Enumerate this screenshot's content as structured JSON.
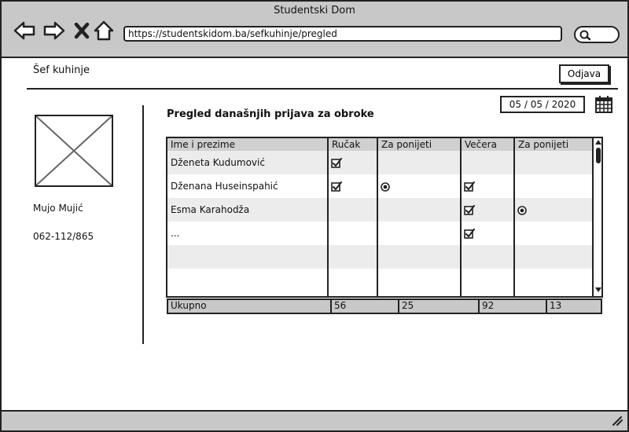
{
  "window": {
    "title": "Studentski Dom",
    "url": "https://studentskidom.ba/sefkuhinje/pregled"
  },
  "header": {
    "app_name": "Šef kuhinje",
    "logout_label": "Odjava"
  },
  "user": {
    "name": "Mujo Mujić",
    "phone": "062-112/865"
  },
  "main": {
    "title": "Pregled današnjih prijava za obroke",
    "date": "05 / 05 / 2020"
  },
  "table": {
    "columns": [
      "Ime i prezime",
      "Ručak",
      "Za ponijeti",
      "Večera",
      "Za ponijeti"
    ],
    "rows": [
      {
        "name": "Dženeta Kudumović",
        "rucak": true,
        "rucak_ponijeti": false,
        "vecera": false,
        "vecera_ponijeti": false
      },
      {
        "name": "Dženana Huseinspahić",
        "rucak": true,
        "rucak_ponijeti": true,
        "vecera": true,
        "vecera_ponijeti": false
      },
      {
        "name": "Esma Karahodža",
        "rucak": false,
        "rucak_ponijeti": false,
        "vecera": true,
        "vecera_ponijeti": true
      },
      {
        "name": "...",
        "rucak": false,
        "rucak_ponijeti": false,
        "vecera": true,
        "vecera_ponijeti": false
      },
      {
        "name": "",
        "rucak": false,
        "rucak_ponijeti": false,
        "vecera": false,
        "vecera_ponijeti": false
      },
      {
        "name": "",
        "rucak": false,
        "rucak_ponijeti": false,
        "vecera": false,
        "vecera_ponijeti": false
      }
    ],
    "totals": {
      "label": "Ukupno",
      "values": [
        "56",
        "25",
        "92",
        "13"
      ]
    }
  },
  "colors": {
    "chrome_bg": "#c8c8c8",
    "stripe": "#ececec",
    "ink": "#222222"
  }
}
